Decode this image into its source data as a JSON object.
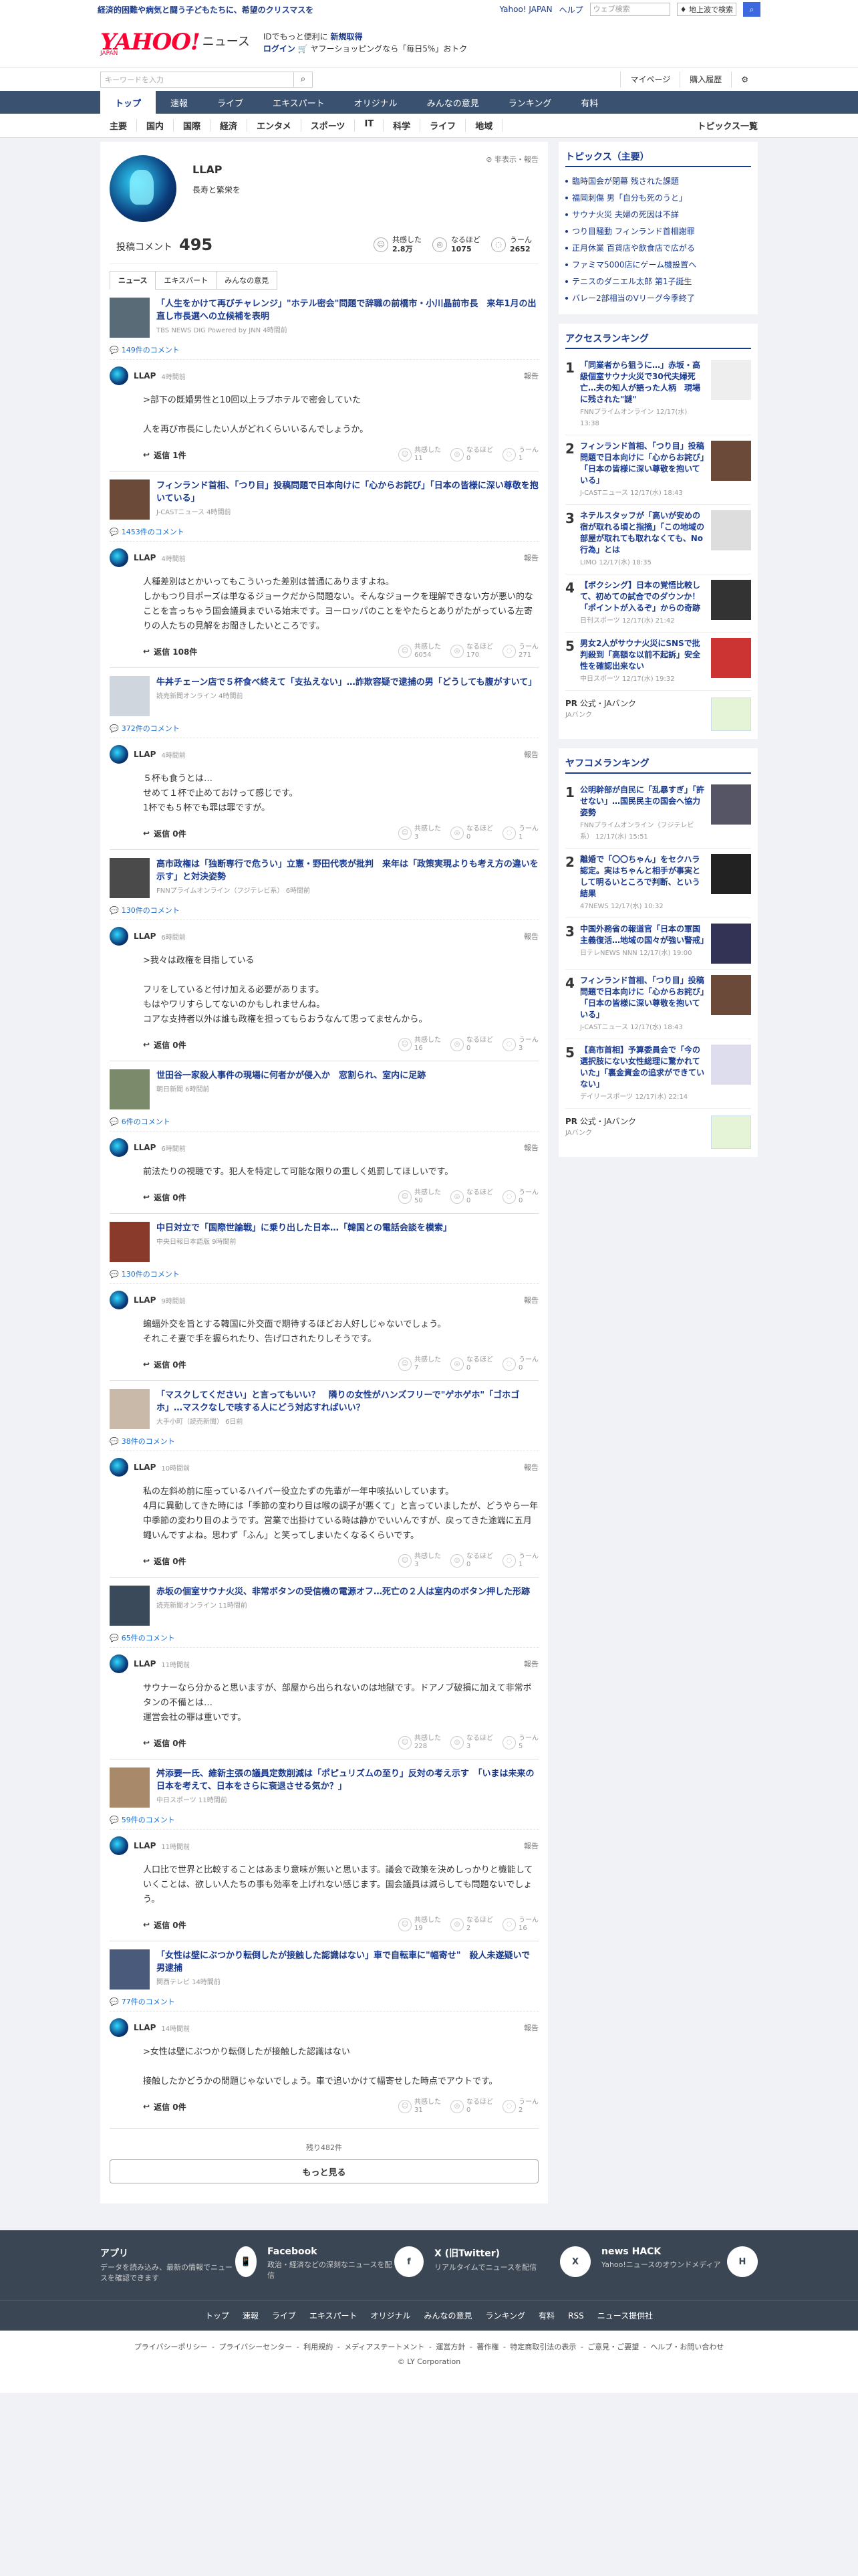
{
  "topbar": {
    "promo": "経済的困難や病気と闘う子どもたちに、希望のクリスマスを",
    "links": [
      "Yahoo! JAPAN",
      "ヘルプ"
    ],
    "web_search_placeholder": "ウェブ検索",
    "news_search_label": "♦ 地上波で検索"
  },
  "header": {
    "logo_main": "YAHOO!",
    "logo_sub": "JAPAN",
    "logo_news": "ニュース",
    "msg1": "IDでもっと便利に",
    "msg1_link": "新規取得",
    "msg2_login": "ログイン",
    "msg2_rest": " 🛒 ヤフーショッピングなら「毎日5%」おトク"
  },
  "subbar": {
    "keyword_placeholder": "キーワードを入力",
    "mypage": "マイページ",
    "history": "購入履歴"
  },
  "nav1": [
    "トップ",
    "速報",
    "ライブ",
    "エキスパート",
    "オリジナル",
    "みんなの意見",
    "ランキング",
    "有料"
  ],
  "nav2": {
    "items": [
      "主要",
      "国内",
      "国際",
      "経済",
      "エンタメ",
      "スポーツ",
      "IT",
      "科学",
      "ライフ",
      "地域"
    ],
    "topics": "トピックス一覧"
  },
  "profile": {
    "name": "LLAP",
    "bio": "長寿と繁栄を",
    "options": "非表示・報告"
  },
  "stats": {
    "comment_label": "投稿コメント",
    "comment_count": "495",
    "reacts": [
      {
        "label": "共感した",
        "value": "2.8万"
      },
      {
        "label": "なるほど",
        "value": "1075"
      },
      {
        "label": "うーん",
        "value": "2652"
      }
    ]
  },
  "tabs": [
    "ニュース",
    "エキスパート",
    "みんなの意見"
  ],
  "entries": [
    {
      "title": "「人生をかけて再びチャレンジ」\"ホテル密会\"問題で辞職の前橋市・小川晶前市長　来年1月の出直し市長選への立候補を表明",
      "source": "TBS NEWS DIG Powered by JNN 4時間前",
      "count": "149件のコメント",
      "time": "4時間前",
      "body": ">部下の既婚男性と10回以上ラブホテルで密会していた\n\n人を再び市長にしたい人がどれくらいいるんでしょうか。",
      "reply": "返信 1件",
      "r": [
        "11",
        "0",
        "1"
      ],
      "thumb": "#5a6b78"
    },
    {
      "title": "フィンランド首相、「つり目」投稿問題で日本向けに「心からお詫び」「日本の皆様に深い尊敬を抱いている」",
      "source": "J-CASTニュース 4時間前",
      "count": "1453件のコメント",
      "time": "4時間前",
      "body": "人種差別はとかいってもこういった差別は普通にありますよね。\nしかもつり目ポーズは単なるジョークだから問題ない。そんなジョークを理解できない方が悪い的なことを言っちゃう国会議員までいる始末です。ヨーロッパのことをやたらとありがたがっている左寄りの人たちの見解をお聞きしたいところです。",
      "reply": "返信 108件",
      "r": [
        "6054",
        "170",
        "271"
      ],
      "thumb": "#6b4a3a"
    },
    {
      "title": "牛丼チェーン店で５杯食べ終えて「支払えない」…詐欺容疑で逮捕の男「どうしても腹がすいて」",
      "source": "読売新聞オンライン 4時間前",
      "count": "372件のコメント",
      "time": "4時間前",
      "body": "５杯も食うとは…\nせめて１杯で止めておけって感じです。\n1杯でも５杯でも罪は罪ですが。",
      "reply": "返信 0件",
      "r": [
        "3",
        "0",
        "1"
      ],
      "thumb": "#cfd6dd"
    },
    {
      "title": "高市政権は「独断専行で危うい」立憲・野田代表が批判　来年は「政策実現よりも考え方の違いを示す」と対決姿勢",
      "source": "FNNプライムオンライン（フジテレビ系） 6時間前",
      "count": "130件のコメント",
      "time": "6時間前",
      "body": ">我々は政権を目指している\n\nフリをしていると付け加える必要があります。\nもはやワリすらしてないのかもしれませんね。\nコアな支持者以外は誰も政権を担ってもらおうなんて思ってませんから。",
      "reply": "返信 0件",
      "r": [
        "16",
        "0",
        "3"
      ],
      "thumb": "#4a4a4a"
    },
    {
      "title": "世田谷一家殺人事件の現場に何者かが侵入か　窓割られ、室内に足跡",
      "source": "朝日新聞 6時間前",
      "count": "6件のコメント",
      "time": "6時間前",
      "body": "前法たりの視聴です。犯人を特定して可能な限りの重しく処罰してほしいです。",
      "reply": "返信 0件",
      "r": [
        "50",
        "0",
        "0"
      ],
      "thumb": "#7a8a6a"
    },
    {
      "title": "中日対立で「国際世論戦」に乗り出した日本…「韓国との電話会談を模索」",
      "source": "中央日報日本語版 9時間前",
      "count": "130件のコメント",
      "time": "9時間前",
      "body": "蝙蝠外交を旨とする韓国に外交面で期待するほどお人好しじゃないでしょう。\nそれこそ妻で手を握られたり、告げ口されたりしそうです。",
      "reply": "返信 0件",
      "r": [
        "7",
        "0",
        "0"
      ],
      "thumb": "#8a3a2a"
    },
    {
      "title": "「マスクしてください」と言ってもいい？　隣りの女性がハンズフリーで\"ゲホゲホ\"「ゴホゴホ」…マスクなしで咳する人にどう対応すればいい？",
      "source": "大手小町（読売新聞） 6日前",
      "count": "38件のコメント",
      "time": "10時間前",
      "body": "私の左斜め前に座っているハイパー役立たずの先輩が一年中咳払いしています。\n4月に異動してきた時には「季節の変わり目は喉の調子が悪くて」と言っていましたが、どうやら一年中季節の変わり目のようです。営業で出掛けている時は静かでいいんですが、戻ってきた途端に五月蠅いんですよね。思わず「ふん」と笑ってしまいたくなるくらいです。",
      "reply": "返信 0件",
      "r": [
        "3",
        "0",
        "1"
      ],
      "thumb": "#c9b9a9"
    },
    {
      "title": "赤坂の個室サウナ火災、非常ボタンの受信機の電源オフ…死亡の２人は室内のボタン押した形跡",
      "source": "読売新聞オンライン 11時間前",
      "count": "65件のコメント",
      "time": "11時間前",
      "body": "サウナーなら分かると思いますが、部屋から出られないのは地獄です。ドアノブ破損に加えて非常ボタンの不備とは…\n運営会社の罪は重いです。",
      "reply": "返信 0件",
      "r": [
        "228",
        "3",
        "5"
      ],
      "thumb": "#3a4a5a"
    },
    {
      "title": "舛添要一氏、維新主張の議員定数削減は「ポピュリズムの至り」反対の考え示す　「いまは未来の日本を考えて、日本をさらに衰退させる気か？」",
      "source": "中日スポーツ 11時間前",
      "count": "59件のコメント",
      "time": "11時間前",
      "body": "人口比で世界と比較することはあまり意味が無いと思います。議会で政策を決めしっかりと機能していくことは、欲しい人たちの事も効率を上げれない感じます。国会議員は減らしても問題ないでしょう。",
      "reply": "返信 0件",
      "r": [
        "19",
        "2",
        "16"
      ],
      "thumb": "#a88a6a"
    },
    {
      "title": "「女性は壁にぶつかり転倒したが接触した認識はない」車で自転車に\"幅寄せ\"　殺人未遂疑いで男逮捕",
      "source": "関西テレビ 14時間前",
      "count": "77件のコメント",
      "time": "14時間前",
      "body": ">女性は壁にぶつかり転倒したが接触した認識はない\n\n接触したかどうかの問題じゃないでしょう。車で追いかけて幅寄せした時点でアウトです。",
      "reply": "返信 0件",
      "r": [
        "31",
        "0",
        "2"
      ],
      "thumb": "#4a5a7a"
    }
  ],
  "more": {
    "remaining": "残り482件",
    "button": "もっと見る"
  },
  "topics_box": {
    "title": "トピックス（主要）",
    "items": [
      "臨時国会が閉幕 残された課題",
      "福岡刺傷 男「自分も死のうと」",
      "サウナ火災 夫婦の死因は不詳",
      "つり目騒動 フィンランド首相謝罪",
      "正月休業 百貨店や飲食店で広がる",
      "ファミマ5000店にゲーム機設置へ",
      "テニスのダニエル太郎 第1子誕生",
      "バレー2部相当のVリーグ今季終了"
    ]
  },
  "access_ranking": {
    "title": "アクセスランキング",
    "items": [
      {
        "no": "1",
        "t": "「同業者から狙うに…」赤坂・高級個室サウナ火災で30代夫婦死亡…夫の知人が語った人柄　現場に残された\"謎\"",
        "s": "FNNプライムオンライン 12/17(水) 13:38",
        "c": "#eee"
      },
      {
        "no": "2",
        "t": "フィンランド首相、「つり目」投稿問題で日本向けに「心からお詫び」「日本の皆様に深い尊敬を抱いている」",
        "s": "J-CASTニュース 12/17(水) 18:43",
        "c": "#6b4a3a"
      },
      {
        "no": "3",
        "t": "ネテルスタッフが「高いが安めの宿が取れる頃と指摘」「この地域の部屋が取れても取れなくても、No行為」とは",
        "s": "LIMO 12/17(水) 18:35",
        "c": "#ddd"
      },
      {
        "no": "4",
        "t": "【ボクシング】日本の覚悟比較して、初めての試合でのダウンか！ 「ポイントが入るぞ」からの奇跡",
        "s": "日刊スポーツ 12/17(水) 21:42",
        "c": "#333"
      },
      {
        "no": "5",
        "t": "男女2人がサウナ火災にSNSで批判殺到「高額な以前不起訴」安全性を確認出来ない",
        "s": "中日スポーツ 12/17(水) 19:32",
        "c": "#c33"
      }
    ]
  },
  "pr1": {
    "label": "公式・JAバンク",
    "sub": "JAバンク"
  },
  "yafuko_ranking": {
    "title": "ヤフコメランキング",
    "items": [
      {
        "no": "1",
        "t": "公明幹部が自民に「乱暴すぎ」「許せない」…国民民主の国会へ協力姿勢",
        "s": "FNNプライムオンライン（フジテレビ系） 12/17(水) 15:51",
        "c": "#556"
      },
      {
        "no": "2",
        "t": "離婚で「〇〇ちゃん」をセクハラ認定。実はちゃんと相手が事実として明るいところで判断、という結果",
        "s": "47NEWS 12/17(水) 10:32",
        "c": "#222"
      },
      {
        "no": "3",
        "t": "中国外務省の報道官「日本の軍国主義復活…地域の国々が強い警戒」",
        "s": "日テレNEWS NNN 12/17(水) 19:00",
        "c": "#335"
      },
      {
        "no": "4",
        "t": "フィンランド首相、「つり目」投稿問題で日本向けに「心からお詫び」「日本の皆様に深い尊敬を抱いている」",
        "s": "J-CASTニュース 12/17(水) 18:43",
        "c": "#6b4a3a"
      },
      {
        "no": "5",
        "t": "【高市首相】予算委員会で「今の選択肢にない女性総理に驚かれていた」「裏金資金の追求ができていない」",
        "s": "デイリースポーツ 12/17(水) 22:14",
        "c": "#dde"
      }
    ]
  },
  "pr2": {
    "label": "公式・JAバンク",
    "sub": "JAバンク"
  },
  "apps": [
    {
      "t": "アプリ",
      "d": "データを読み込み、最新の情報でニュースを確認できます",
      "ic": "📱"
    },
    {
      "t": "Facebook",
      "d": "政治・経済などの深刻なニュースを配信",
      "ic": "f"
    },
    {
      "t": "X (旧Twitter)",
      "d": "リアルタイムでニュースを配信",
      "ic": "X"
    },
    {
      "t": "news HACK",
      "d": "Yahoo!ニュースのオウンドメディア",
      "ic": "H"
    }
  ],
  "footer_nav": [
    "トップ",
    "速報",
    "ライブ",
    "エキスパート",
    "オリジナル",
    "みんなの意見",
    "ランキング",
    "有料",
    "RSS",
    "ニュース提供社"
  ],
  "legal": {
    "links": [
      "プライバシーポリシー",
      "プライバシーセンター",
      "利用規約",
      "メディアステートメント",
      "運営方針",
      "著作権",
      "特定商取引法の表示",
      "ご意見・ご要望",
      "ヘルプ・お問い合わせ"
    ],
    "copy": "© LY Corporation"
  }
}
